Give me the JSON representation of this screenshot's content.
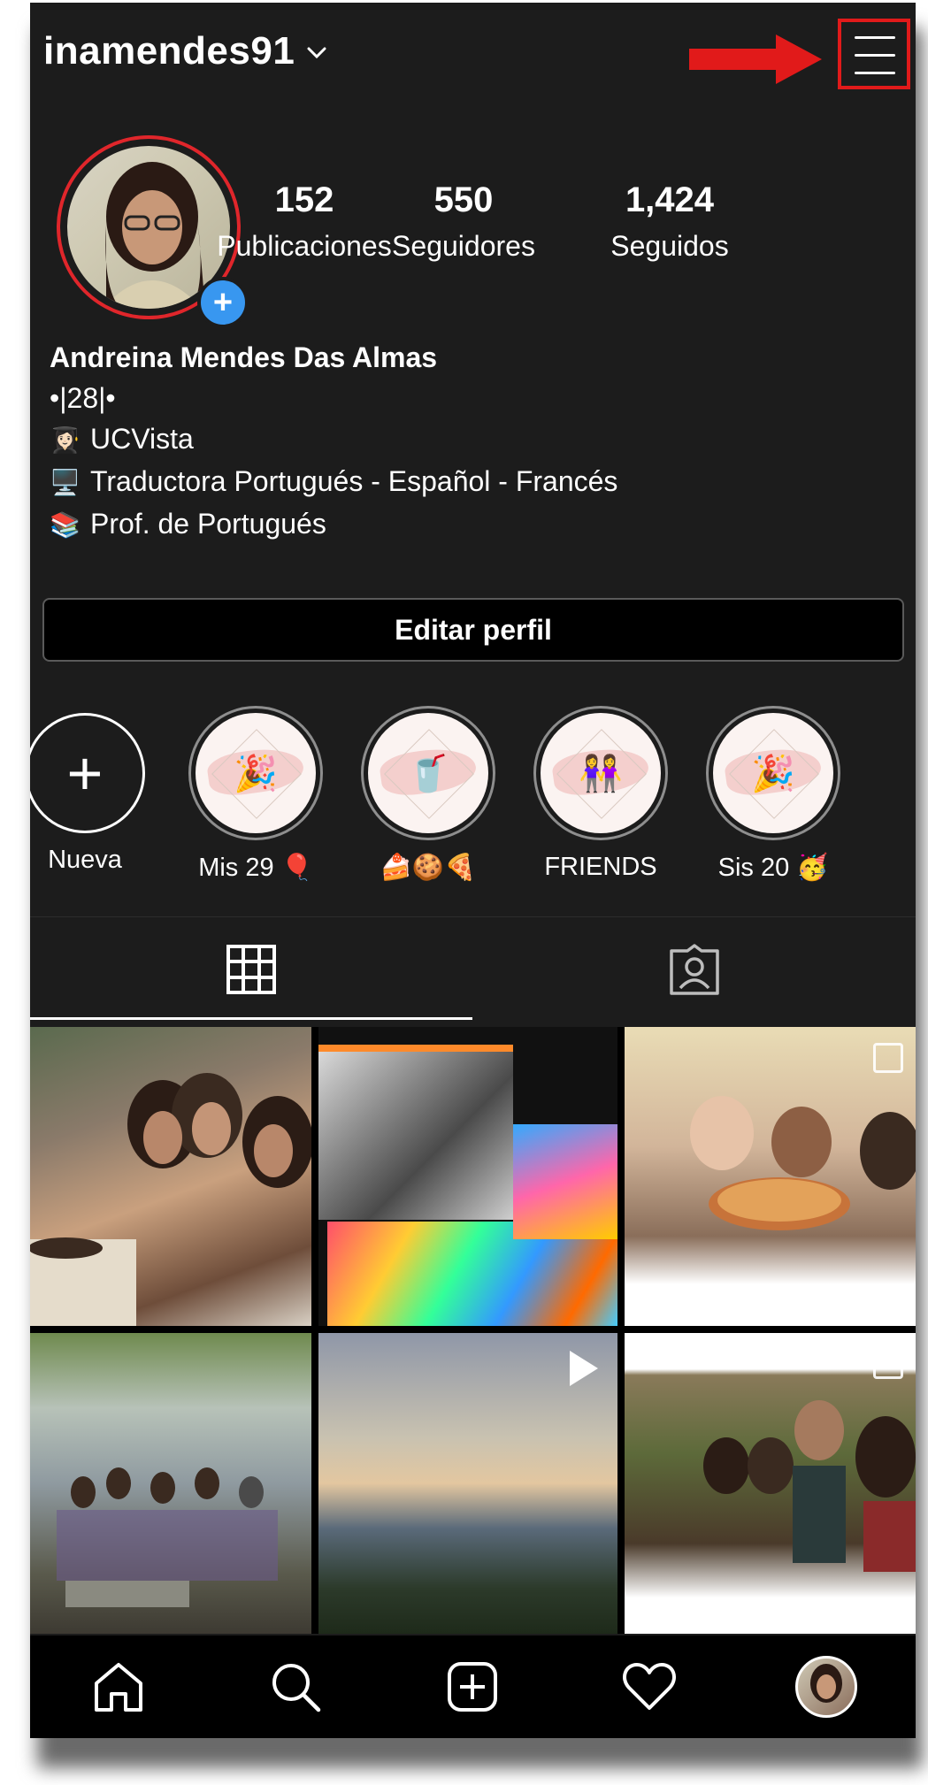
{
  "header": {
    "username": "inamendes91",
    "menu_icon": "hamburger-menu-icon",
    "annotation_arrow_color": "#e11a1a"
  },
  "profile": {
    "stats": [
      {
        "value": "152",
        "label": "Publicaciones"
      },
      {
        "value": "550",
        "label": "Seguidores"
      },
      {
        "value": "1,424",
        "label": "Seguidos"
      }
    ],
    "name": "Andreina Mendes Das Almas",
    "bio": [
      {
        "icon": "",
        "text": "•|28|•"
      },
      {
        "icon": "👩🏻‍🎓",
        "text": "UCVista"
      },
      {
        "icon": "🖥️",
        "text": "Traductora Portugués - Español - Francés"
      },
      {
        "icon": "📚",
        "text": "Prof. de Portugués"
      }
    ],
    "edit_button": "Editar perfil"
  },
  "highlights": [
    {
      "label": "Nueva"
    },
    {
      "label": "Mis 29 🎈",
      "glyph": "🎉"
    },
    {
      "label": "🍰🍪🍕",
      "glyph": "🥤"
    },
    {
      "label": "FRIENDS",
      "glyph": "👭"
    },
    {
      "label": "Sis 20 🥳",
      "glyph": "🎉"
    }
  ],
  "tabs": {
    "grid_icon": "grid-icon",
    "tagged_icon": "tagged-person-icon"
  },
  "nav": {
    "items": [
      "home-icon",
      "search-icon",
      "new-post-icon",
      "activity-heart-icon",
      "profile-avatar"
    ]
  },
  "colors": {
    "background": "#1c1c1c",
    "story_ring": "#e0262b",
    "badge": "#3897f0"
  }
}
